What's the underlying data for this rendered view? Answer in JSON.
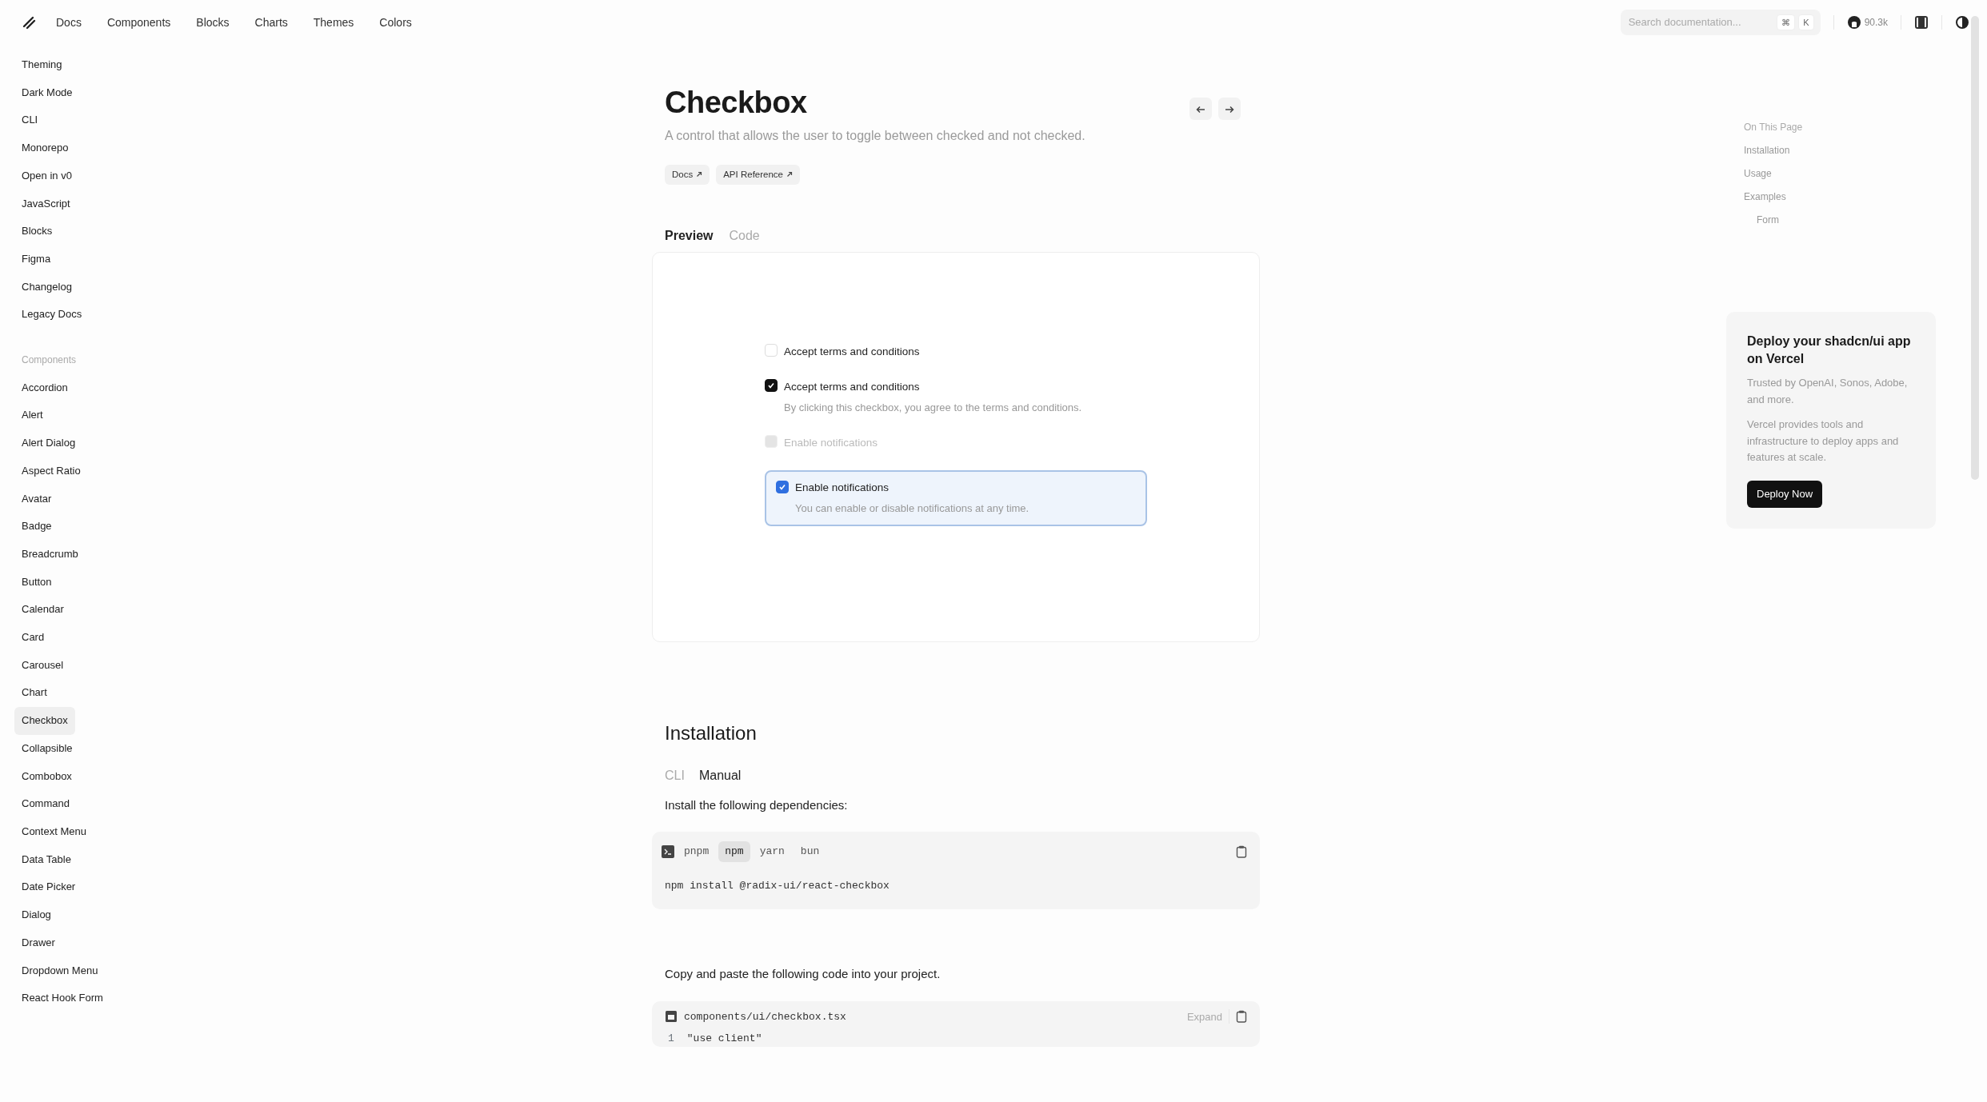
{
  "navbar": {
    "links": [
      "Docs",
      "Components",
      "Blocks",
      "Charts",
      "Themes",
      "Colors"
    ],
    "search": {
      "placeholder": "Search documentation...",
      "keys": [
        "⌘",
        "K"
      ]
    },
    "github_stars": "90.3k"
  },
  "sidebar": {
    "top_items": [
      {
        "label": "Theming",
        "selected": false
      },
      {
        "label": "Dark Mode",
        "selected": false
      },
      {
        "label": "CLI",
        "selected": false
      },
      {
        "label": "Monorepo",
        "selected": false
      },
      {
        "label": "Open in v0",
        "selected": false
      },
      {
        "label": "JavaScript",
        "selected": false
      },
      {
        "label": "Blocks",
        "selected": false
      },
      {
        "label": "Figma",
        "selected": false
      },
      {
        "label": "Changelog",
        "selected": false
      },
      {
        "label": "Legacy Docs",
        "selected": false
      }
    ],
    "section_title": "Components",
    "items": [
      {
        "label": "Accordion",
        "selected": false
      },
      {
        "label": "Alert",
        "selected": false
      },
      {
        "label": "Alert Dialog",
        "selected": false
      },
      {
        "label": "Aspect Ratio",
        "selected": false
      },
      {
        "label": "Avatar",
        "selected": false
      },
      {
        "label": "Badge",
        "selected": false
      },
      {
        "label": "Breadcrumb",
        "selected": false
      },
      {
        "label": "Button",
        "selected": false
      },
      {
        "label": "Calendar",
        "selected": false
      },
      {
        "label": "Card",
        "selected": false
      },
      {
        "label": "Carousel",
        "selected": false
      },
      {
        "label": "Chart",
        "selected": false
      },
      {
        "label": "Checkbox",
        "selected": true
      },
      {
        "label": "Collapsible",
        "selected": false
      },
      {
        "label": "Combobox",
        "selected": false
      },
      {
        "label": "Command",
        "selected": false
      },
      {
        "label": "Context Menu",
        "selected": false
      },
      {
        "label": "Data Table",
        "selected": false
      },
      {
        "label": "Date Picker",
        "selected": false
      },
      {
        "label": "Dialog",
        "selected": false
      },
      {
        "label": "Drawer",
        "selected": false
      },
      {
        "label": "Dropdown Menu",
        "selected": false
      },
      {
        "label": "React Hook Form",
        "selected": false
      }
    ]
  },
  "page": {
    "title": "Checkbox",
    "description": "A control that allows the user to toggle between checked and not checked.",
    "links": [
      "Docs",
      "API Reference"
    ],
    "view_tabs": [
      {
        "label": "Preview",
        "selected": true
      },
      {
        "label": "Code",
        "selected": false
      }
    ],
    "preview": [
      {
        "kind": "plain",
        "label": "Accept terms and conditions",
        "checked": false,
        "disabled": false
      },
      {
        "kind": "plain",
        "label": "Accept terms and conditions",
        "description": "By clicking this checkbox, you agree to the terms and conditions.",
        "checked": true,
        "disabled": false
      },
      {
        "kind": "plain",
        "label": "Enable notifications",
        "checked": false,
        "disabled": true
      },
      {
        "kind": "card",
        "label": "Enable notifications",
        "description": "You can enable or disable notifications at any time.",
        "checked": true,
        "disabled": false
      }
    ],
    "installation": {
      "heading": "Installation",
      "tabs": [
        {
          "label": "CLI",
          "selected": false
        },
        {
          "label": "Manual",
          "selected": true
        }
      ],
      "step1": "Install the following dependencies:",
      "package_managers": [
        {
          "label": "pnpm",
          "selected": false
        },
        {
          "label": "npm",
          "selected": true
        },
        {
          "label": "yarn",
          "selected": false
        },
        {
          "label": "bun",
          "selected": false
        }
      ],
      "command": "npm install @radix-ui/react-checkbox",
      "step2": "Copy and paste the following code into your project.",
      "file": {
        "name": "components/ui/checkbox.tsx",
        "expand": "Expand",
        "lines": [
          {
            "number": "1",
            "code": "\"use client\""
          }
        ]
      }
    }
  },
  "toc": {
    "title": "On This Page",
    "items": [
      {
        "label": "Installation"
      },
      {
        "label": "Usage"
      },
      {
        "label": "Examples",
        "children": [
          {
            "label": "Form"
          }
        ]
      }
    ]
  },
  "promo": {
    "title": "Deploy your shadcn/ui app on Vercel",
    "lines": [
      "Trusted by OpenAI, Sonos, Adobe, and more.",
      "Vercel provides tools and infrastructure to deploy apps and features at scale."
    ],
    "button": "Deploy Now"
  }
}
